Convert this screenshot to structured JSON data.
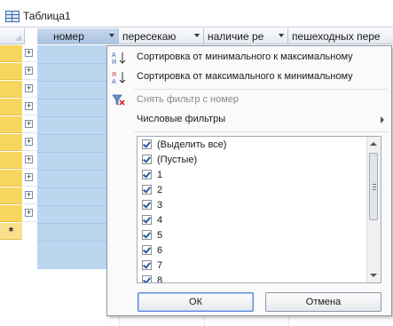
{
  "tab": {
    "title": "Таблица1"
  },
  "columns": [
    {
      "label": "номер"
    },
    {
      "label": "пересекаю"
    },
    {
      "label": "наличие ре"
    },
    {
      "label": "пешеходных пере"
    }
  ],
  "new_row_marker": "*",
  "expand_glyph": "+",
  "menu": {
    "sort_asc": "Сортировка от минимального к максимальному",
    "sort_desc": "Сортировка от максимального к минимальному",
    "clear_filter": "Снять фильтр с номер",
    "number_filters": "Числовые фильтры",
    "values": [
      "(Выделить все)",
      "(Пустые)",
      "1",
      "2",
      "3",
      "4",
      "5",
      "6",
      "7",
      "8"
    ],
    "ok": "ОК",
    "cancel": "Отмена"
  },
  "colors": {
    "selector": "#f7d65e",
    "selected_column": "#bcd6f0"
  }
}
